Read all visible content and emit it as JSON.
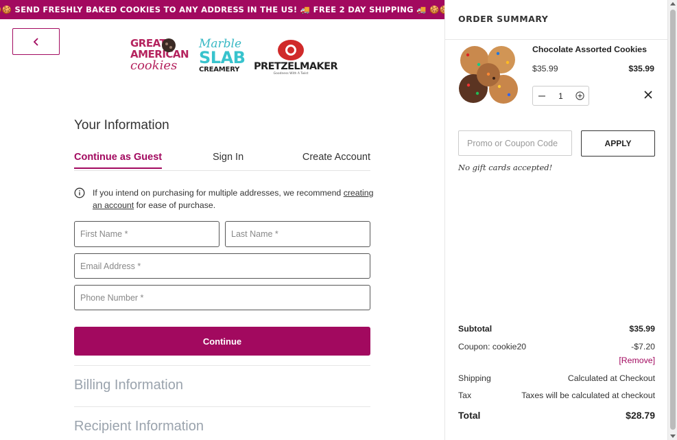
{
  "banner": {
    "text": "🍪🍪 SEND FRESHLY BAKED COOKIES TO ANY ADDRESS IN THE US! 🚚 FREE 2 DAY SHIPPING 🚚 🍪🍪."
  },
  "brands": {
    "great_american": {
      "line1": "GREAT",
      "line2": "AMERICAN",
      "line3": "cookies"
    },
    "marble_slab": {
      "line1": "Marble",
      "line2": "SLAB",
      "line3": "CREAMERY"
    },
    "pretzelmaker": {
      "line1": "PRETZELMAKER",
      "tagline": "Goodness With A Twist"
    }
  },
  "your_info": {
    "title": "Your Information",
    "tabs": [
      {
        "label": "Continue as Guest",
        "active": true
      },
      {
        "label": "Sign In",
        "active": false
      },
      {
        "label": "Create Account",
        "active": false
      }
    ],
    "notice": {
      "before": "If you intend on purchasing for multiple addresses, we recommend ",
      "link": "creating an account",
      "after": " for ease of purchase."
    },
    "fields": {
      "first_name": {
        "placeholder": "First Name *",
        "value": ""
      },
      "last_name": {
        "placeholder": "Last Name *",
        "value": ""
      },
      "email": {
        "placeholder": "Email Address *",
        "value": ""
      },
      "phone": {
        "placeholder": "Phone Number *",
        "value": ""
      }
    },
    "continue_label": "Continue"
  },
  "sections": {
    "billing": "Billing Information",
    "recipient": "Recipient Information"
  },
  "summary": {
    "title": "ORDER SUMMARY",
    "item": {
      "name": "Chocolate Assorted Cookies",
      "price": "$35.99",
      "line_total": "$35.99",
      "quantity": "1"
    },
    "promo": {
      "placeholder": "Promo or Coupon Code",
      "apply_label": "APPLY",
      "note": "No gift cards accepted!"
    },
    "totals": {
      "subtotal": {
        "label": "Subtotal",
        "value": "$35.99"
      },
      "coupon": {
        "label": "Coupon: cookie20",
        "value": "-$7.20",
        "remove": "[Remove]"
      },
      "shipping": {
        "label": "Shipping",
        "value": "Calculated at Checkout"
      },
      "tax": {
        "label": "Tax",
        "value": "Taxes will be calculated at checkout"
      },
      "total": {
        "label": "Total",
        "value": "$28.79"
      }
    }
  },
  "colors": {
    "brand": "#a2095f",
    "muted_heading": "#9aa3ad",
    "border": "#e6e6e6"
  },
  "icons": [
    "chevron-left-icon",
    "info-icon",
    "minus-icon",
    "plus-icon",
    "close-icon",
    "cookie-icon",
    "delivery-truck-icon"
  ]
}
